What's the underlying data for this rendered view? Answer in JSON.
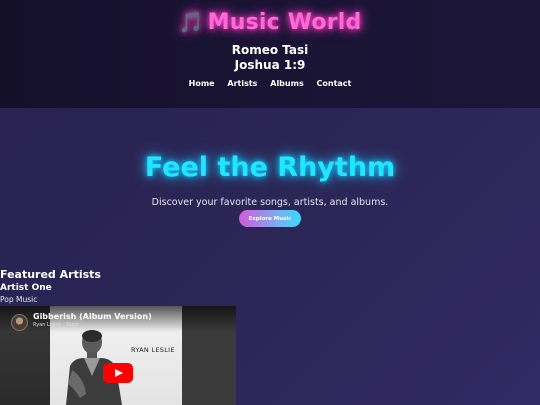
{
  "header": {
    "logo_icon": "🎵",
    "logo_text": "Music World",
    "author": "Romeo Tasi",
    "verse": "Joshua 1:9",
    "nav": [
      "Home",
      "Artists",
      "Albums",
      "Contact"
    ]
  },
  "hero": {
    "title": "Feel the Rhythm",
    "subtitle": "Discover your favorite songs, artists, and albums.",
    "button": "Explore Music"
  },
  "featured": {
    "section_title": "Featured Artists",
    "artist_name": "Artist One",
    "artist_genre": "Pop Music",
    "video": {
      "title": "Gibberish (Album Version)",
      "channel": "Ryan Leslie - Topic",
      "cover_text": "RYAN LESLIE",
      "play_icon": "youtube-play-icon"
    }
  },
  "colors": {
    "logo_pink": "#ff6ad5",
    "hero_cyan": "#21e6ff",
    "button_gradient_start": "#d35bdb",
    "button_gradient_end": "#3ad8ff",
    "header_bg": "#14102a",
    "main_bg": "#2a2352",
    "play_red": "#ff0000"
  }
}
